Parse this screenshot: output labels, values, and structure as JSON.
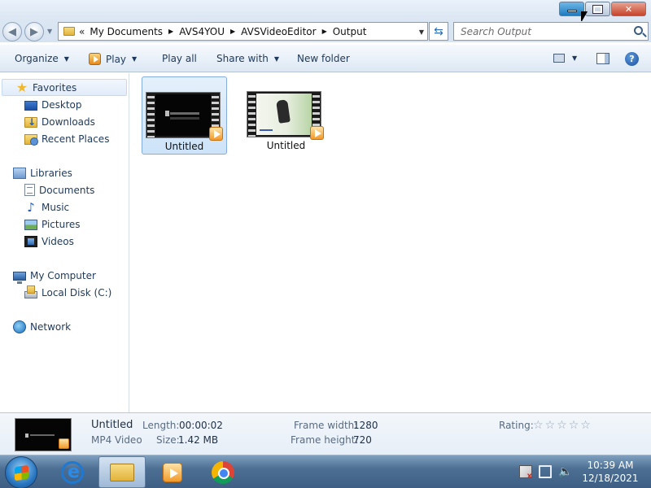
{
  "window": {
    "minimize_icon": "minimize-icon",
    "maximize_icon": "restore-icon",
    "close_label": "✕"
  },
  "address": {
    "overflow": "«",
    "crumbs": [
      "My Documents",
      "AVS4YOU",
      "AVSVideoEditor",
      "Output"
    ]
  },
  "search": {
    "placeholder": "Search Output"
  },
  "toolbar": {
    "organize": "Organize",
    "play": "Play",
    "play_all": "Play all",
    "share_with": "Share with",
    "new_folder": "New folder",
    "help": "?"
  },
  "nav": {
    "favorites": {
      "header": "Favorites",
      "items": [
        "Desktop",
        "Downloads",
        "Recent Places"
      ]
    },
    "libraries": {
      "header": "Libraries",
      "items": [
        "Documents",
        "Music",
        "Pictures",
        "Videos"
      ]
    },
    "computer": {
      "header": "My Computer",
      "items": [
        "Local Disk (C:)"
      ]
    },
    "network": {
      "header": "Network"
    }
  },
  "files": [
    {
      "name": "Untitled",
      "selected": true
    },
    {
      "name": "Untitled",
      "selected": false
    }
  ],
  "details": {
    "name": "Untitled",
    "type": "MP4 Video",
    "length_label": "Length:",
    "length": "00:00:02",
    "size_label": "Size:",
    "size": "1.42 MB",
    "frame_width_label": "Frame width:",
    "frame_width": "1280",
    "frame_height_label": "Frame height:",
    "frame_height": "720",
    "rating_label": "Rating:",
    "rating_stars": 0,
    "rating_max": 5
  },
  "taskbar": {
    "apps": [
      "internet-explorer-icon",
      "windows-explorer-icon",
      "avs-video-editor-icon",
      "chrome-icon"
    ],
    "time": "10:39 AM",
    "date": "12/18/2021"
  }
}
